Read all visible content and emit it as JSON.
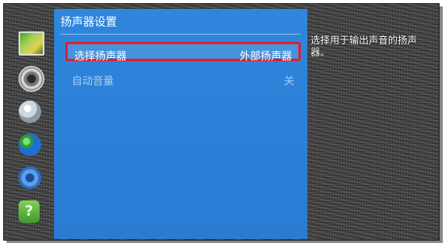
{
  "menu": {
    "title": "扬声器设置",
    "items": [
      {
        "label": "选择扬声器",
        "value": "外部扬声器",
        "selected": true
      },
      {
        "label": "自动音量",
        "value": "关",
        "selected": false
      }
    ]
  },
  "help": {
    "text": "选择用于输出声音的扬声器。"
  },
  "sidebar": {
    "icons": [
      "picture-icon",
      "sound-icon",
      "broadcast-icon",
      "network-globe-icon",
      "system-gear-icon",
      "support-icon"
    ],
    "support_glyph": "?"
  },
  "colors": {
    "panel": "#2c80d8",
    "selection_border": "#e0202a",
    "disabled_text": "#a9cdf2"
  }
}
